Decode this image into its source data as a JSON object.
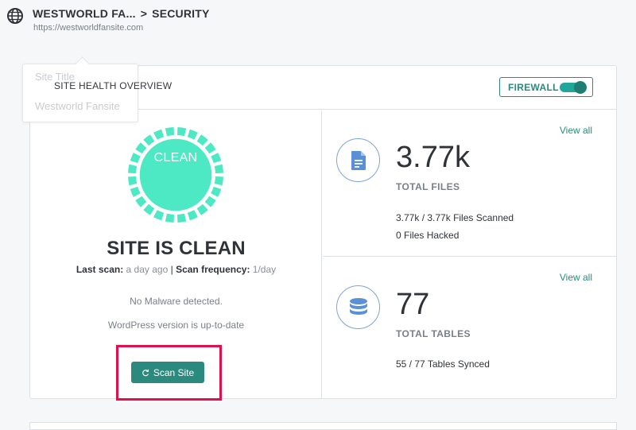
{
  "header": {
    "site_name": "WESTWORLD FA...",
    "separator": ">",
    "section": "SECURITY",
    "url": "https://westworldfansite.com"
  },
  "tooltip": {
    "label": "Site Title",
    "value": "Westworld Fansite"
  },
  "overview": {
    "title": "SITE HEALTH OVERVIEW",
    "firewall_label": "FIREWALL",
    "firewall_on": true
  },
  "health": {
    "badge": "CLEAN",
    "status": "SITE IS CLEAN",
    "last_scan_label": "Last scan:",
    "last_scan_value": "a day ago",
    "divider": "|",
    "frequency_label": "Scan frequency:",
    "frequency_value": "1/day",
    "message_malware": "No Malware detected.",
    "message_wp": "WordPress version is up-to-date",
    "scan_button": "Scan Site"
  },
  "files": {
    "view_all": "View all",
    "count": "3.77k",
    "label": "TOTAL FILES",
    "scanned_value": "3.77k / 3.77k",
    "scanned_label": "Files Scanned",
    "hacked_value": "0",
    "hacked_label": "Files Hacked"
  },
  "tables": {
    "view_all": "View all",
    "count": "77",
    "label": "TOTAL TABLES",
    "synced_value": "55 / 77",
    "synced_label": "Tables Synced"
  },
  "colors": {
    "accent": "#2a8a7d",
    "badge": "#4de8c4",
    "highlight": "#e0104d",
    "icon_blue": "#5b8fd6"
  },
  "icons": [
    "globe-icon",
    "document-icon",
    "database-icon",
    "refresh-icon"
  ]
}
